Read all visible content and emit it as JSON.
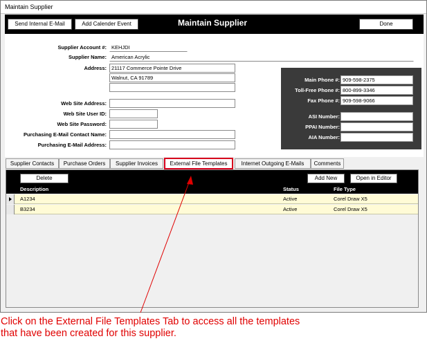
{
  "window": {
    "title": "Maintain Supplier"
  },
  "header": {
    "send_email_label": "Send Internal E-Mail",
    "add_calendar_label": "Add Calender Event",
    "title": "Maintain Supplier",
    "done_label": "Done"
  },
  "form": {
    "account_label": "Supplier Account #:",
    "account_value": "KEHJDI",
    "name_label": "Supplier Name:",
    "name_value": "American Acrylic",
    "address_label": "Address:",
    "address_line1": "21117 Commerce Pointe Drive",
    "address_line2": "Walnut, CA 91789",
    "address_line3": "",
    "website_label": "Web Site Address:",
    "website_value": "",
    "webuser_label": "Web Site User ID:",
    "webuser_value": "",
    "webpass_label": "Web Site Password:",
    "webpass_value": "",
    "purch_contact_label": "Purchasing E-Mail Contact Name:",
    "purch_contact_value": "",
    "purch_email_label": "Purchasing E-Mail Address:",
    "purch_email_value": ""
  },
  "phones": {
    "main_label": "Main Phone #:",
    "main_value": "909-598-2375",
    "tollfree_label": "Toll-Free Phone #:",
    "tollfree_value": "800-899-3346",
    "fax_label": "Fax Phone #:",
    "fax_value": "909-598-9066",
    "asi_label": "ASI Number:",
    "asi_value": "",
    "ppai_label": "PPAI Number:",
    "ppai_value": "",
    "aia_label": "AIA Number:",
    "aia_value": ""
  },
  "tabs": [
    {
      "label": "Supplier Contacts"
    },
    {
      "label": "Purchase Orders"
    },
    {
      "label": "Supplier Invoices"
    },
    {
      "label": "External File Templates"
    },
    {
      "label": "Internet Outgoing E-Mails"
    },
    {
      "label": "Comments"
    }
  ],
  "grid": {
    "delete_label": "Delete",
    "add_new_label": "Add New",
    "open_editor_label": "Open in Editor",
    "col_description": "Description",
    "col_status": "Status",
    "col_filetype": "File Type",
    "rows": [
      {
        "description": "A1234",
        "status": "Active",
        "file_type": "Corel Draw X5"
      },
      {
        "description": "B3234",
        "status": "Active",
        "file_type": "Corel Draw X5"
      }
    ]
  },
  "annotation": {
    "line1": "Click on the External File Templates Tab to access all the templates",
    "line2": "that have been created for this supplier.",
    "color": "#e00000"
  },
  "colors": {
    "header_bg": "#000000",
    "row_bg": "#fffbd6",
    "phone_panel_bg": "#3a3a3a",
    "active_tab_border": "#d6001c"
  }
}
